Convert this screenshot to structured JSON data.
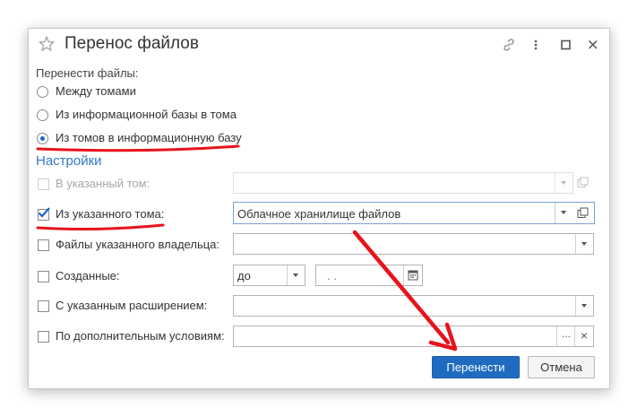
{
  "dialog": {
    "title": "Перенос файлов",
    "move_files_label": "Перенести файлы:",
    "radio_options": [
      {
        "label": "Между томами",
        "selected": false
      },
      {
        "label": "Из информационной базы в тома",
        "selected": false
      },
      {
        "label": "Из томов в информационную базу",
        "selected": true
      }
    ],
    "settings_title": "Настройки",
    "filters": {
      "to_volume": {
        "label": "В указанный том:",
        "checked": false,
        "enabled": false,
        "value": ""
      },
      "from_volume": {
        "label": "Из указанного тома:",
        "checked": true,
        "enabled": true,
        "value": "Облачное хранилище файлов"
      },
      "owner_files": {
        "label": "Файлы указанного владельца:",
        "checked": false,
        "value": ""
      },
      "created": {
        "label": "Созданные:",
        "checked": false,
        "mode": "до",
        "date_placeholder": ".  ."
      },
      "extension": {
        "label": "С указанным расширением:",
        "checked": false,
        "value": ""
      },
      "extra_conditions": {
        "label": "По дополнительным условиям:",
        "checked": false,
        "value": "",
        "select_btn": "...",
        "clear_btn": "×"
      }
    },
    "buttons": {
      "move": "Перенести",
      "cancel": "Отмена"
    }
  },
  "colors": {
    "accent": "#1f6bc2",
    "annotation": "#e8131b",
    "link": "#2f79c7"
  }
}
